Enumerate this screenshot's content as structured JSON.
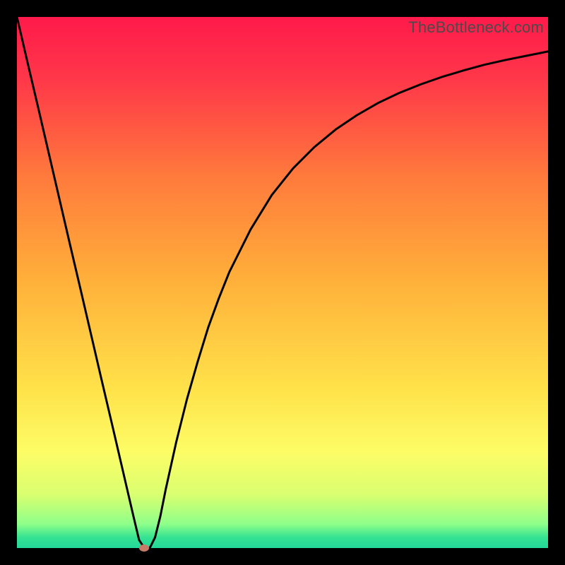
{
  "watermark": "TheBottleneck.com",
  "chart_data": {
    "type": "line",
    "title": "",
    "xlabel": "",
    "ylabel": "",
    "xlim": [
      0,
      100
    ],
    "ylim": [
      0,
      100
    ],
    "grid": false,
    "background_gradient": {
      "stops": [
        {
          "pos": 0.0,
          "color": "#ff1a4b"
        },
        {
          "pos": 0.12,
          "color": "#ff3849"
        },
        {
          "pos": 0.3,
          "color": "#ff7a3c"
        },
        {
          "pos": 0.5,
          "color": "#ffb13a"
        },
        {
          "pos": 0.7,
          "color": "#ffe24a"
        },
        {
          "pos": 0.82,
          "color": "#fdfd66"
        },
        {
          "pos": 0.9,
          "color": "#d9ff70"
        },
        {
          "pos": 0.955,
          "color": "#8eff8a"
        },
        {
          "pos": 0.98,
          "color": "#35e292"
        },
        {
          "pos": 1.0,
          "color": "#23d89a"
        }
      ]
    },
    "series": [
      {
        "name": "bottleneck-curve",
        "color": "#000000",
        "x": [
          0,
          2,
          4,
          6,
          8,
          10,
          12,
          14,
          16,
          18,
          20,
          21,
          22,
          23,
          24,
          25,
          26,
          27,
          28,
          30,
          32,
          34,
          36,
          38,
          40,
          44,
          48,
          52,
          56,
          60,
          64,
          68,
          72,
          76,
          80,
          84,
          88,
          92,
          96,
          100
        ],
        "y": [
          100,
          91.4,
          82.9,
          74.3,
          65.7,
          57.1,
          48.6,
          40.0,
          31.4,
          22.9,
          14.3,
          10.0,
          5.7,
          1.5,
          0.0,
          0.0,
          2.0,
          6.0,
          11.0,
          20.0,
          28.0,
          35.0,
          41.5,
          47.0,
          52.0,
          60.0,
          66.5,
          71.5,
          75.5,
          78.8,
          81.5,
          83.8,
          85.7,
          87.3,
          88.7,
          89.9,
          91.0,
          91.9,
          92.7,
          93.5
        ]
      }
    ],
    "marker": {
      "x": 24.0,
      "y": 0.0,
      "color": "#c77a68"
    }
  }
}
